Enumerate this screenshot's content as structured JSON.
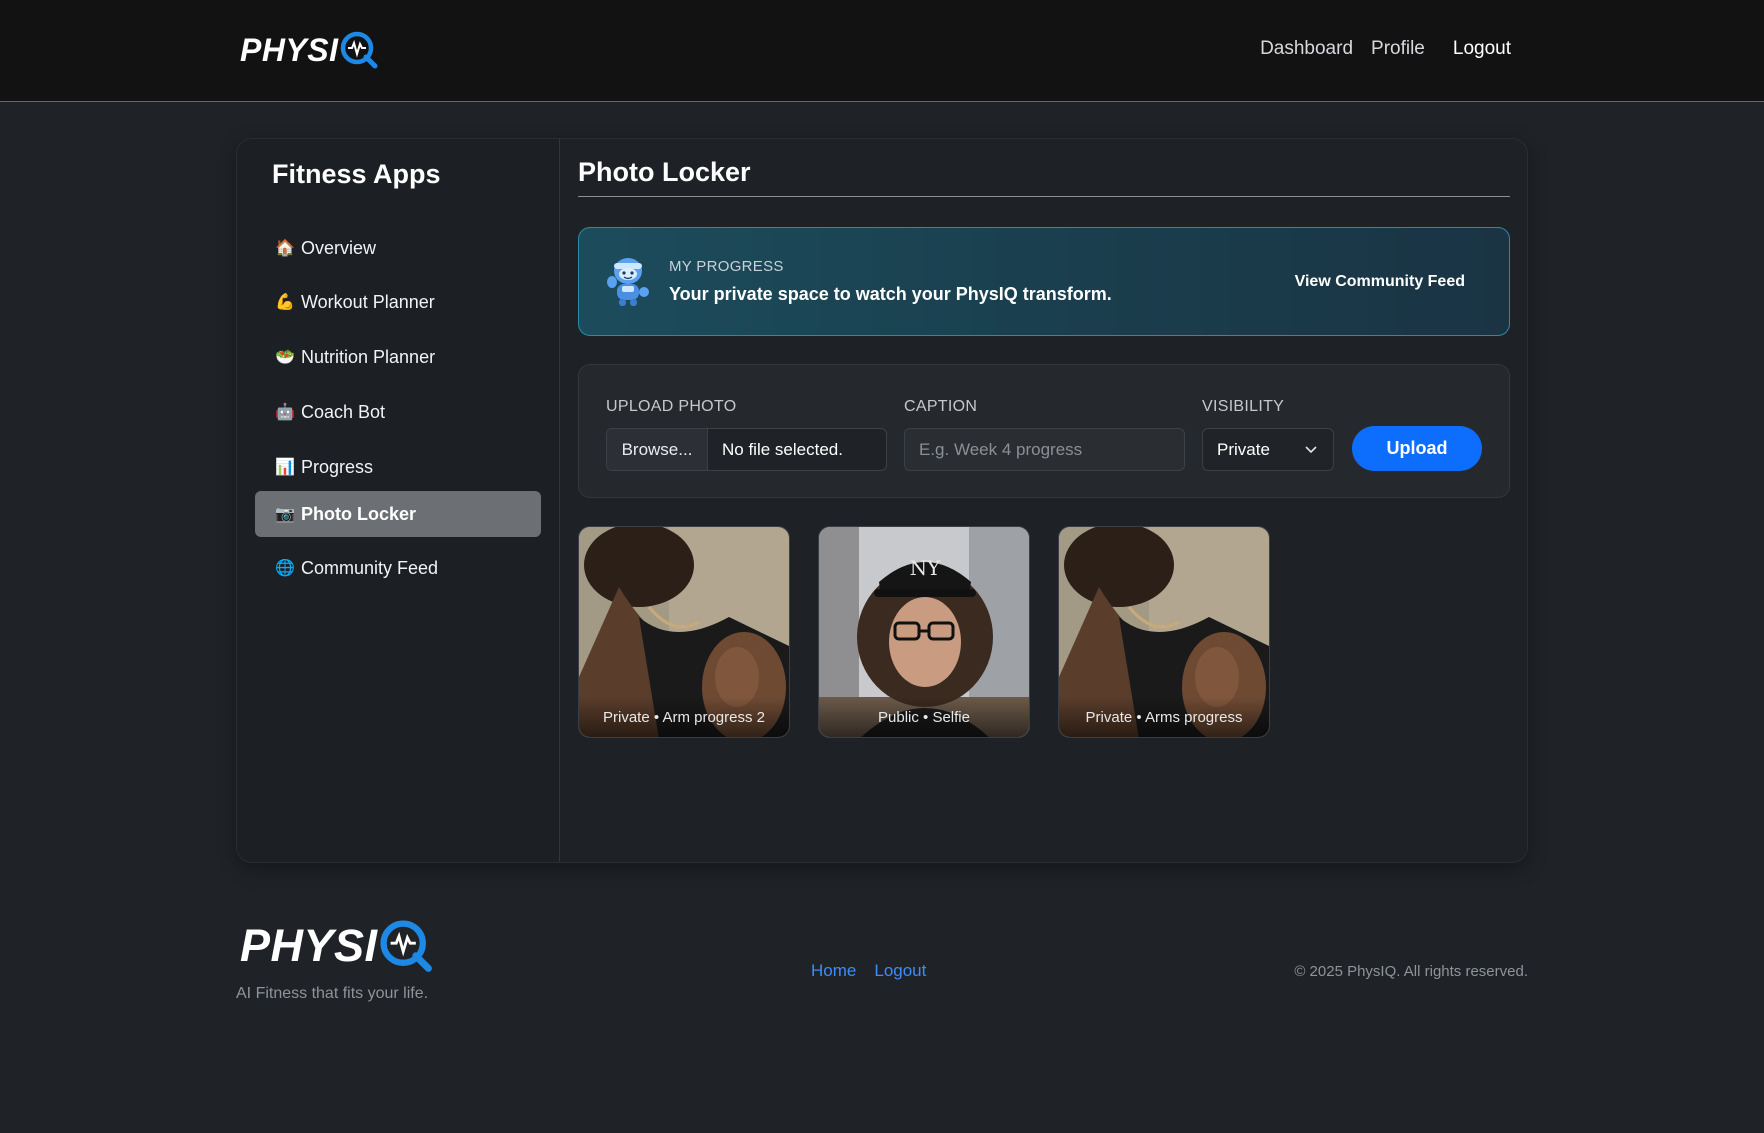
{
  "header": {
    "logo_text": "PHYSIQ",
    "nav": [
      {
        "label": "Dashboard"
      },
      {
        "label": "Profile"
      },
      {
        "label": "Logout"
      }
    ]
  },
  "sidebar": {
    "title": "Fitness Apps",
    "items": [
      {
        "icon": "🏠",
        "label": "Overview"
      },
      {
        "icon": "💪",
        "label": "Workout Planner"
      },
      {
        "icon": "🥗",
        "label": "Nutrition Planner"
      },
      {
        "icon": "🤖",
        "label": "Coach Bot"
      },
      {
        "icon": "📊",
        "label": "Progress"
      },
      {
        "icon": "📷",
        "label": "Photo Locker",
        "active": true
      },
      {
        "icon": "🌐",
        "label": "Community Feed"
      }
    ]
  },
  "main": {
    "title": "Photo Locker",
    "banner": {
      "kicker": "MY PROGRESS",
      "headline": "Your private space to watch your PhysIQ transform.",
      "cta": "View Community Feed"
    },
    "upload": {
      "photo_label": "UPLOAD PHOTO",
      "browse_label": "Browse...",
      "file_status": "No file selected.",
      "caption_label": "CAPTION",
      "caption_placeholder": "E.g. Week 4 progress",
      "visibility_label": "VISIBILITY",
      "visibility_value": "Private",
      "submit_label": "Upload"
    },
    "photos": [
      {
        "caption": "Private • Arm progress 2",
        "subject": "arm-photo"
      },
      {
        "caption": "Public • Selfie",
        "subject": "selfie-photo"
      },
      {
        "caption": "Private • Arms progress",
        "subject": "arm-photo"
      }
    ]
  },
  "footer": {
    "logo_text": "PHYSIQ",
    "tagline": "AI Fitness that fits your life.",
    "links": [
      {
        "label": "Home"
      },
      {
        "label": "Logout"
      }
    ],
    "copyright": "© 2025 PhysIQ. All rights reserved."
  },
  "colors": {
    "accent": "#0d6efd",
    "link": "#3d8bfd",
    "banner_border": "#2c8aa6",
    "background": "#1f2328"
  }
}
